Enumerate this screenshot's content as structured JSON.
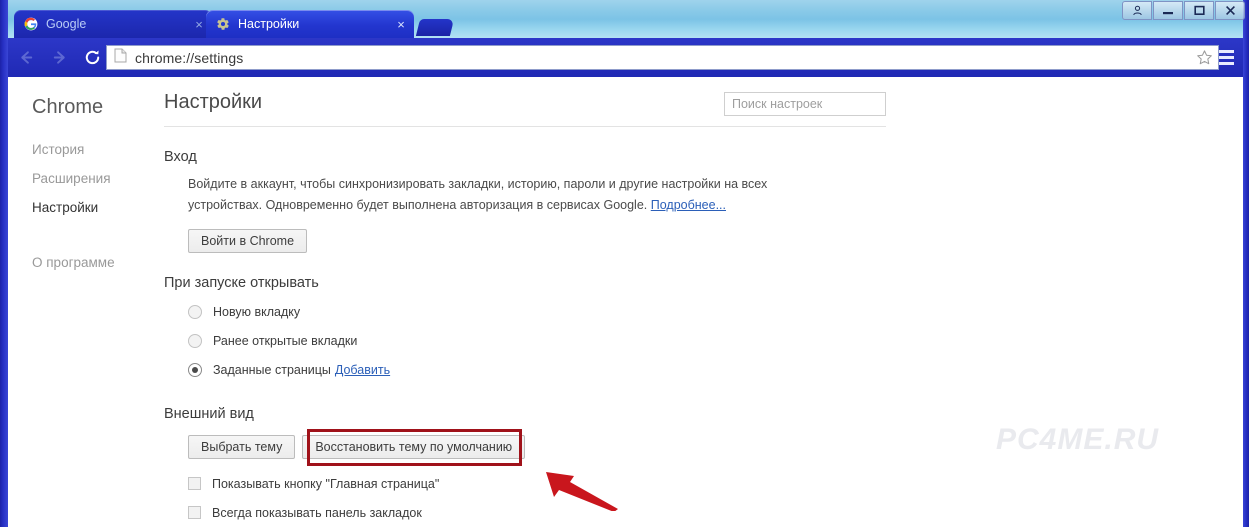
{
  "window": {
    "controls": [
      {
        "name": "person-button",
        "glyph": "person"
      },
      {
        "name": "minimize-button",
        "glyph": "minimize"
      },
      {
        "name": "maximize-button",
        "glyph": "maximize"
      },
      {
        "name": "close-button",
        "glyph": "close"
      }
    ]
  },
  "tabs": [
    {
      "title": "Google",
      "favicon": "google-g-icon",
      "active": false,
      "close_label": "×"
    },
    {
      "title": "Настройки",
      "favicon": "gear-icon",
      "active": true,
      "close_label": "×"
    }
  ],
  "toolbar": {
    "back_icon": "back-arrow-icon",
    "forward_icon": "forward-arrow-icon",
    "reload_icon": "reload-icon",
    "url": "chrome://settings",
    "page_icon": "page-document-icon",
    "star_icon": "bookmark-star-icon",
    "menu_icon": "hamburger-menu-icon"
  },
  "sidebar": {
    "brand": "Chrome",
    "items": [
      {
        "label": "История",
        "name": "sidebar-item-history",
        "active": false,
        "spaced": false
      },
      {
        "label": "Расширения",
        "name": "sidebar-item-extensions",
        "active": false,
        "spaced": false
      },
      {
        "label": "Настройки",
        "name": "sidebar-item-settings",
        "active": true,
        "spaced": false
      },
      {
        "label": "О программе",
        "name": "sidebar-item-about",
        "active": false,
        "spaced": true
      }
    ]
  },
  "main": {
    "title": "Настройки",
    "search_placeholder": "Поиск настроек",
    "search_value": "",
    "signin": {
      "title": "Вход",
      "description": "Войдите в аккаунт, чтобы синхронизировать закладки, историю, пароли и другие настройки на всех устройствах. Одновременно будет выполнена авторизация в сервисах Google.",
      "learn_more": "Подробнее...",
      "button": "Войти в Chrome"
    },
    "startup": {
      "title": "При запуске открывать",
      "options": [
        {
          "label": "Новую вкладку",
          "selected": false,
          "link": ""
        },
        {
          "label": "Ранее открытые вкладки",
          "selected": false,
          "link": ""
        },
        {
          "label": "Заданные страницы",
          "selected": true,
          "link": "Добавить"
        }
      ]
    },
    "appearance": {
      "title": "Внешний вид",
      "choose_theme_button": "Выбрать тему",
      "reset_theme_button": "Восстановить тему по умолчанию",
      "checkboxes": [
        {
          "label": "Показывать кнопку \"Главная страница\"",
          "checked": false
        },
        {
          "label": "Всегда показывать панель закладок",
          "checked": false
        }
      ]
    }
  },
  "annotation": {
    "box_color": "#a0121a",
    "arrow_color": "#c9161d"
  },
  "watermark": "PC4ME.RU"
}
